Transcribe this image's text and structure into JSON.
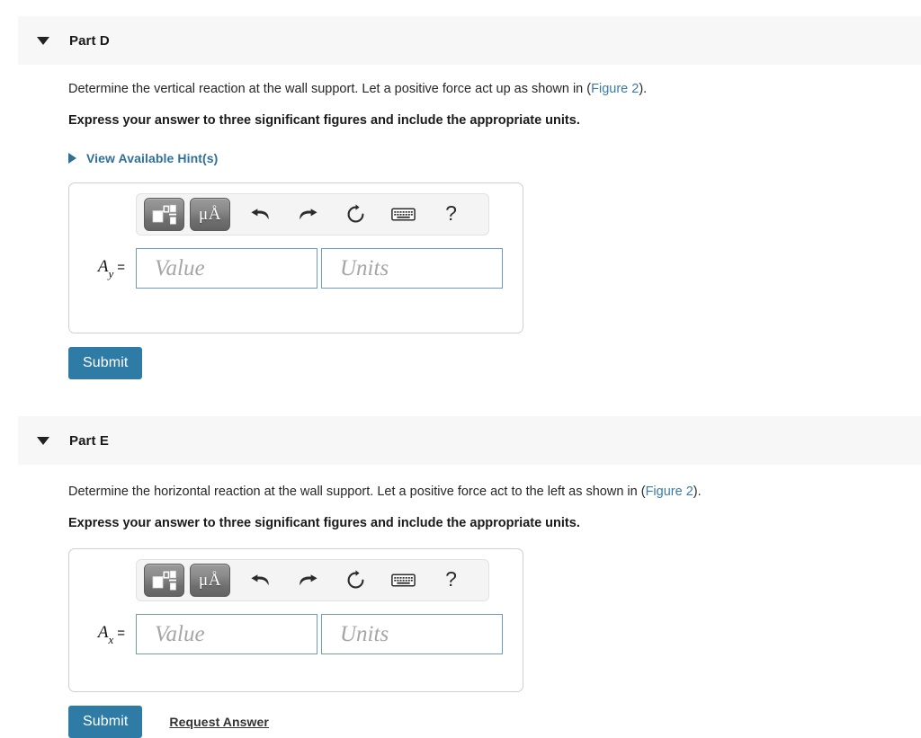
{
  "parts": [
    {
      "id": "part-d",
      "title": "Part D",
      "prompt_before_link": "Determine the vertical reaction at the wall support. Let a positive force act up as shown in (",
      "prompt_link": "Figure 2",
      "prompt_after_link": ").",
      "instruction": "Express your answer to three significant figures and include the appropriate units.",
      "hints_label": "View Available Hint(s)",
      "has_hints": true,
      "variable_name": "A",
      "variable_subscript": "y",
      "equals": "=",
      "value_placeholder": "Value",
      "units_placeholder": "Units",
      "submit_label": "Submit",
      "request_answer_label": "",
      "has_request_answer": false,
      "toolbar": {
        "template_button": "math-template-button",
        "units_button_label": "μÅ",
        "undo_label": "undo",
        "redo_label": "redo",
        "reset_label": "reset",
        "keyboard_label": "keyboard",
        "help_label": "?"
      }
    },
    {
      "id": "part-e",
      "title": "Part E",
      "prompt_before_link": "Determine the horizontal reaction at the wall support. Let a positive force act to the left as shown in (",
      "prompt_link": "Figure 2",
      "prompt_after_link": ").",
      "instruction": "Express your answer to three significant figures and include the appropriate units.",
      "hints_label": "",
      "has_hints": false,
      "variable_name": "A",
      "variable_subscript": "x",
      "equals": "=",
      "value_placeholder": "Value",
      "units_placeholder": "Units",
      "submit_label": "Submit",
      "request_answer_label": "Request Answer",
      "has_request_answer": true,
      "toolbar": {
        "template_button": "math-template-button",
        "units_button_label": "μÅ",
        "undo_label": "undo",
        "redo_label": "redo",
        "reset_label": "reset",
        "keyboard_label": "keyboard",
        "help_label": "?"
      }
    }
  ],
  "colors": {
    "band_background": "#f7f7f7",
    "link": "#3a7ca5",
    "hint_link": "#2e7096",
    "submit_background": "#2e7ba6",
    "input_border": "#6d9cc0",
    "placeholder": "#a6a6a6",
    "text": "#262626"
  }
}
